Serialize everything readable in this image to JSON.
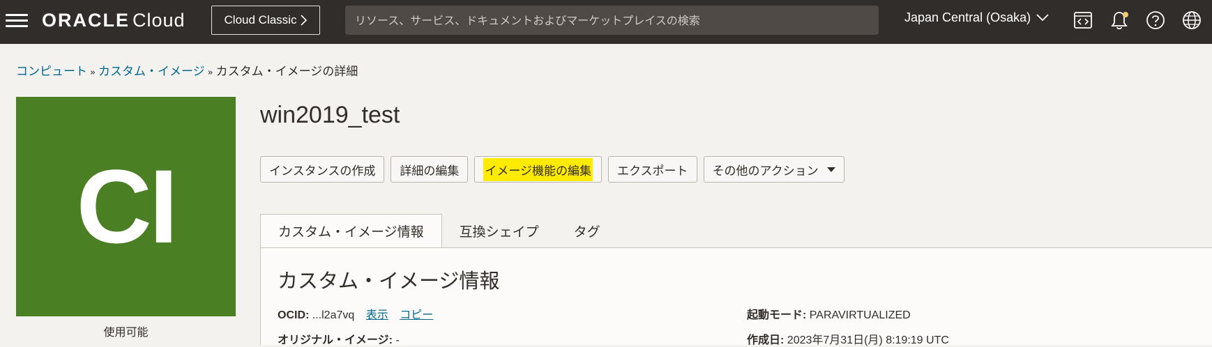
{
  "nav": {
    "brand": "ORACLE",
    "brand_sub": "Cloud",
    "classic_button": "Cloud Classic",
    "search_placeholder": "リソース、サービス、ドキュメントおよびマーケットプレイスの検索",
    "region": "Japan Central (Osaka)",
    "icons": [
      "menu-icon",
      "code-editor-icon",
      "bell-icon",
      "help-icon",
      "globe-icon"
    ]
  },
  "breadcrumb": {
    "items": [
      "コンピュート",
      "カスタム・イメージ"
    ],
    "current": "カスタム・イメージの詳細"
  },
  "badge": {
    "initials": "CI",
    "status": "使用可能",
    "color": "#4a7f23"
  },
  "image": {
    "name": "win2019_test"
  },
  "actions": {
    "create_instance": "インスタンスの作成",
    "edit_details": "詳細の編集",
    "edit_capabilities": "イメージ機能の編集",
    "export": "エクスポート",
    "more_actions": "その他のアクション"
  },
  "tabs": [
    "カスタム・イメージ情報",
    "互換シェイプ",
    "タグ"
  ],
  "info": {
    "heading": "カスタム・イメージ情報",
    "ocid_label": "OCID:",
    "ocid_value": "...l2a7vq",
    "show_link": "表示",
    "copy_link": "コピー",
    "original_label": "オリジナル・イメージ:",
    "original_value": "-",
    "launch_mode_label": "起動モード:",
    "launch_mode_value": "PARAVIRTUALIZED",
    "created_label": "作成日:",
    "created_value": "2023年7月31日(月) 8:19:19 UTC"
  },
  "colors": {
    "topbar": "#312d2a",
    "link": "#00688c",
    "highlight": "#ffeb00"
  }
}
